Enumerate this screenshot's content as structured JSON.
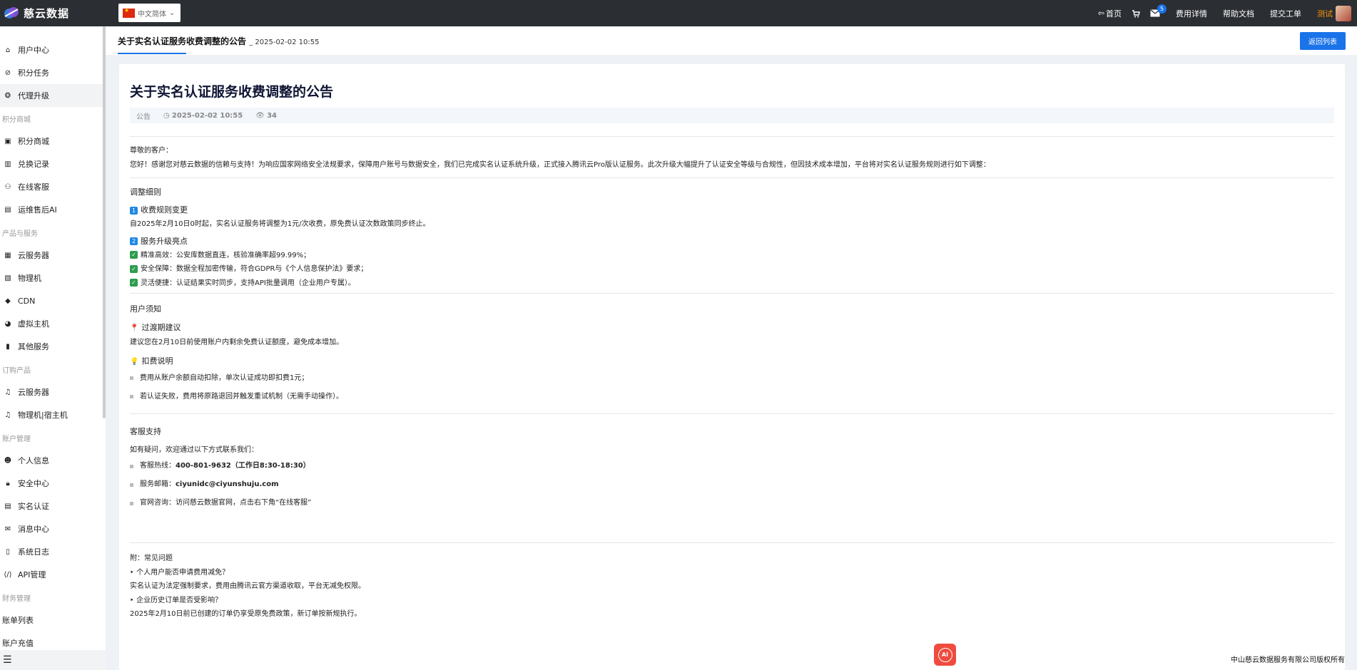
{
  "brand": {
    "name": "慈云数据"
  },
  "language": {
    "selected": "中文简体"
  },
  "topnav": {
    "home": "首页",
    "mail_badge": "5",
    "billing": "费用详情",
    "help": "帮助文档",
    "ticket": "提交工单",
    "user": "测试"
  },
  "sidebar": {
    "items": [
      {
        "type": "item",
        "label": "用户中心",
        "icon": "home-icon"
      },
      {
        "type": "item",
        "label": "积分任务",
        "icon": "check-circle-icon"
      },
      {
        "type": "item",
        "label": "代理升级",
        "icon": "upgrade-icon",
        "active": true
      },
      {
        "type": "group",
        "label": "积分商城"
      },
      {
        "type": "item",
        "label": "积分商城",
        "icon": "shop-icon"
      },
      {
        "type": "item",
        "label": "兑换记录",
        "icon": "book-icon"
      },
      {
        "type": "item",
        "label": "在线客服",
        "icon": "support-icon"
      },
      {
        "type": "item",
        "label": "运维售后AI",
        "icon": "ai-icon"
      },
      {
        "type": "group",
        "label": "产品与服务"
      },
      {
        "type": "item",
        "label": "云服务器",
        "icon": "grid-icon"
      },
      {
        "type": "item",
        "label": "物理机",
        "icon": "server-icon"
      },
      {
        "type": "item",
        "label": "CDN",
        "icon": "cdn-icon"
      },
      {
        "type": "item",
        "label": "虚拟主机",
        "icon": "globe-icon"
      },
      {
        "type": "item",
        "label": "其他服务",
        "icon": "doc-icon"
      },
      {
        "type": "group",
        "label": "订购产品"
      },
      {
        "type": "item",
        "label": "云服务器",
        "icon": "bell-icon"
      },
      {
        "type": "item",
        "label": "物理机|宿主机",
        "icon": "bell-icon"
      },
      {
        "type": "group",
        "label": "账户管理"
      },
      {
        "type": "item",
        "label": "个人信息",
        "icon": "user-icon"
      },
      {
        "type": "item",
        "label": "安全中心",
        "icon": "lock-icon"
      },
      {
        "type": "item",
        "label": "实名认证",
        "icon": "id-card-icon"
      },
      {
        "type": "item",
        "label": "消息中心",
        "icon": "mail-icon"
      },
      {
        "type": "item",
        "label": "系统日志",
        "icon": "log-icon"
      },
      {
        "type": "item",
        "label": "API管理",
        "icon": "code-icon"
      },
      {
        "type": "group",
        "label": "财务管理"
      },
      {
        "type": "item",
        "label": "账单列表",
        "icon": ""
      },
      {
        "type": "item",
        "label": "账户充值",
        "icon": ""
      }
    ]
  },
  "tab": {
    "title": "关于实名认证服务收费调整的公告",
    "date": "_ 2025-02-02 10:55",
    "back_label": "返回列表"
  },
  "article": {
    "title": "关于实名认证服务收费调整的公告",
    "category": "公告",
    "time": "2025-02-02 10:55",
    "views": "34",
    "greeting": "尊敬的客户：",
    "intro": "您好！感谢您对慈云数据的信赖与支持！为响应国家网络安全法规要求，保障用户账号与数据安全，我们已完成实名认证系统升级，正式接入腾讯云Pro版认证服务。此次升级大幅提升了认证安全等级与合规性，但因技术成本增加，平台将对实名认证服务规则进行如下调整：",
    "s1_title": "调整细则",
    "s1_n1": "1",
    "s1_h1": "收费规则变更",
    "s1_p1": "自2025年2月10日0时起，实名认证服务将调整为1元/次收费，原免费认证次数政策同步终止。",
    "s1_n2": "2",
    "s1_h2": "服务升级亮点",
    "s1_c1": "精准高效：公安库数据直连，核验准确率超99.99%；",
    "s1_c2": "安全保障：数据全程加密传输，符合GDPR与《个人信息保护法》要求；",
    "s1_c3": "灵活便捷：认证结果实时同步，支持API批量调用（企业用户专属）。",
    "s2_title": "用户须知",
    "s2_h1": "过渡期建议",
    "s2_p1": "建议您在2月10日前使用账户内剩余免费认证额度，避免成本增加。",
    "s2_h2": "扣费说明",
    "s2_b1": "费用从账户余额自动扣除，单次认证成功即扣费1元；",
    "s2_b2": "若认证失败，费用将原路退回并触发重试机制（无需手动操作）。",
    "s3_title": "客服支持",
    "s3_p1": "如有疑问，欢迎通过以下方式联系我们：",
    "s3_b1_label": "客服热线：",
    "s3_b1_value": "400-801-9632（工作日8:30-18:30）",
    "s3_b2_label": "服务邮箱：",
    "s3_b2_value": "ciyunidc@ciyunshuju.com",
    "s3_b3": "官网咨询：访问慈云数据官网，点击右下角“在线客服”",
    "faq_title": "附：常见问题",
    "faq_q1": "‣ 个人用户能否申请费用减免？",
    "faq_a1": "实名认证为法定强制要求，费用由腾讯云官方渠道收取，平台无减免权限。",
    "faq_q2": "‣ 企业历史订单是否受影响？",
    "faq_a2": "2025年2月10日前已创建的订单仍享受原免费政策，新订单按新规执行。"
  },
  "footer": {
    "copyright": "中山慈云数据服务有限公司版权所有",
    "ai_label": "AI"
  },
  "colors": {
    "accent": "#1a73e8",
    "topbar": "#2b2e33",
    "user": "#ff9800"
  }
}
